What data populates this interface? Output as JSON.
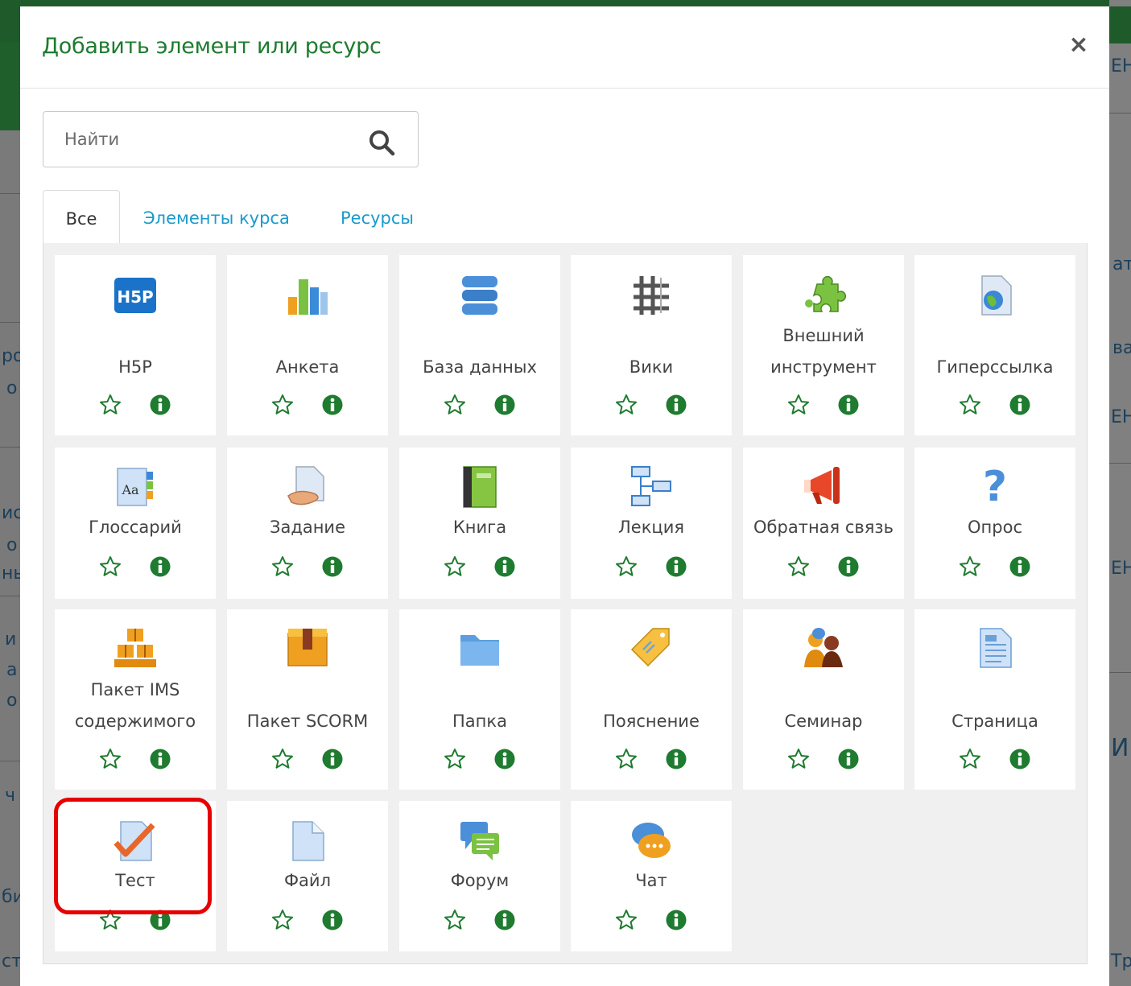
{
  "modal": {
    "title": "Добавить элемент или ресурс",
    "close_label": "×"
  },
  "search": {
    "placeholder": "Найти"
  },
  "tabs": [
    {
      "label": "Все",
      "active": true
    },
    {
      "label": "Элементы курса",
      "active": false
    },
    {
      "label": "Ресурсы",
      "active": false
    }
  ],
  "items": [
    {
      "label": "H5P",
      "icon": "h5p-icon"
    },
    {
      "label": "Анкета",
      "icon": "survey-chart-icon"
    },
    {
      "label": "База данных",
      "icon": "database-icon"
    },
    {
      "label": "Вики",
      "icon": "wiki-icon"
    },
    {
      "label": "Внешний инструмент",
      "line1": "Внешний",
      "line2": "инструмент",
      "icon": "puzzle-piece-icon"
    },
    {
      "label": "Гиперссылка",
      "icon": "url-globe-icon"
    },
    {
      "label": "Глоссарий",
      "icon": "glossary-icon"
    },
    {
      "label": "Задание",
      "icon": "assignment-icon"
    },
    {
      "label": "Книга",
      "icon": "book-icon"
    },
    {
      "label": "Лекция",
      "icon": "lesson-icon"
    },
    {
      "label": "Обратная связь",
      "icon": "megaphone-icon"
    },
    {
      "label": "Опрос",
      "icon": "question-mark-icon"
    },
    {
      "label": "Пакет IMS содержимого",
      "line1": "Пакет IMS",
      "line2": "содержимого",
      "icon": "ims-package-icon"
    },
    {
      "label": "Пакет SCORM",
      "icon": "scorm-box-icon"
    },
    {
      "label": "Папка",
      "icon": "folder-icon"
    },
    {
      "label": "Пояснение",
      "icon": "label-tag-icon"
    },
    {
      "label": "Семинар",
      "icon": "workshop-people-icon"
    },
    {
      "label": "Страница",
      "icon": "page-icon"
    },
    {
      "label": "Тест",
      "icon": "quiz-checkmark-icon"
    },
    {
      "label": "Файл",
      "icon": "file-icon"
    },
    {
      "label": "Форум",
      "icon": "forum-bubbles-icon"
    },
    {
      "label": "Чат",
      "icon": "chat-bubbles-icon"
    }
  ],
  "background_fragments": [
    "ЕН",
    "ат",
    "ва",
    "ЕН",
    "ЕН",
    "И",
    "Тр",
    "ро",
    "о",
    "ис",
    "о",
    "нь",
    "и",
    "а",
    "о",
    "ч",
    "би",
    "ст"
  ],
  "colors": {
    "title_green": "#1e7b2f",
    "tab_link_blue": "#1a9acb",
    "action_green": "#1e7b2f",
    "highlight_red": "#e60000"
  }
}
